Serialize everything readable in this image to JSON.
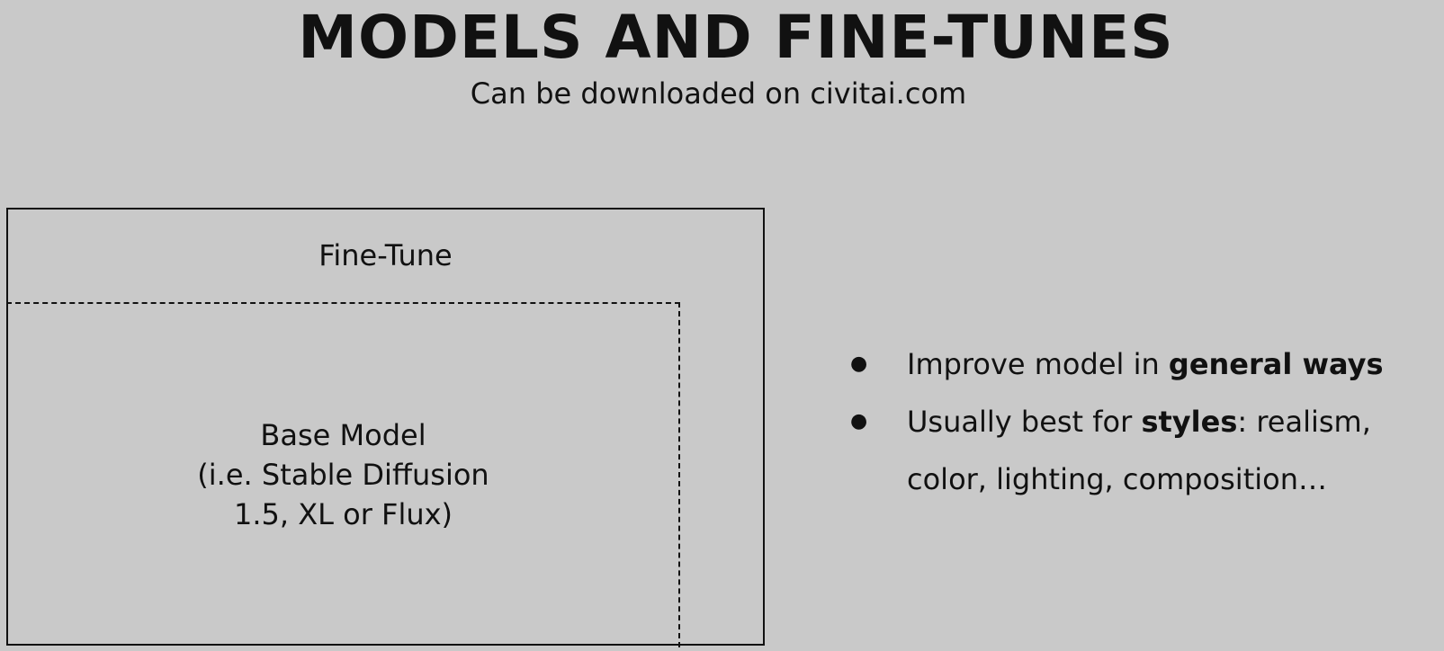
{
  "header": {
    "title": "MODELS AND FINE-TUNES",
    "subtitle": "Can be downloaded on civitai.com"
  },
  "diagram": {
    "outer_label": "Fine-Tune",
    "inner_label_lines": [
      "Base Model",
      "(i.e. Stable Diffusion",
      "1.5, XL or Flux)"
    ]
  },
  "bullets": [
    {
      "prefix": "Improve model in ",
      "bold": "general ways",
      "suffix": ""
    },
    {
      "prefix": "Usually best for ",
      "bold": "styles",
      "suffix": ": realism,"
    }
  ],
  "bullet_continuation": "color, lighting, composition…"
}
